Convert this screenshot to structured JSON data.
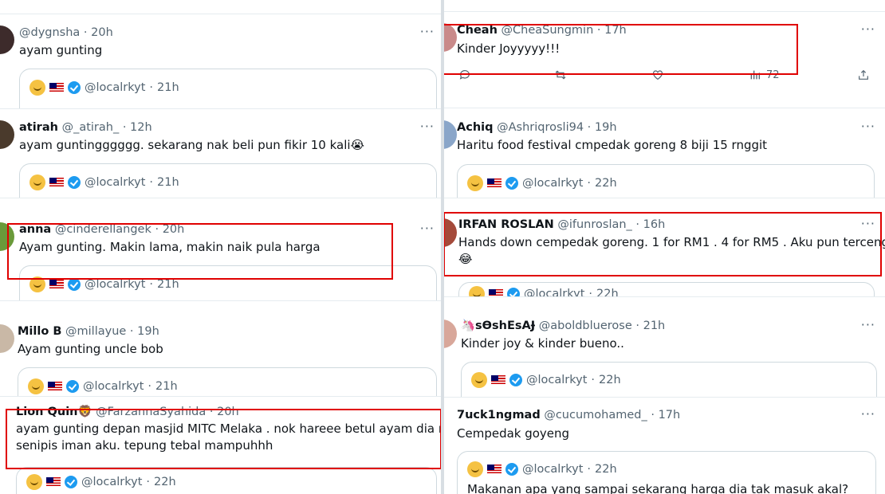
{
  "colors": {
    "accent": "#1d9bf0",
    "highlight": "#e00000"
  },
  "left": [
    {
      "name": "",
      "handle": "@dygnsha",
      "time": "20h",
      "text": "ayam gunting",
      "quote": {
        "handle": "@localrkyt",
        "time": "21h"
      }
    },
    {
      "name": "atirah",
      "handle": "@_atirah_",
      "time": "12h",
      "text": "ayam guntingggggg. sekarang nak beli pun fikir 10 kali😭",
      "quote": {
        "handle": "@localrkyt",
        "time": "21h"
      }
    },
    {
      "name": "anna",
      "handle": "@cinderellangek",
      "time": "20h",
      "text": "Ayam gunting. Makin lama, makin naik pula harga",
      "quote": {
        "handle": "@localrkyt",
        "time": "21h"
      }
    },
    {
      "name": "Millo B",
      "handle": "@millayue",
      "time": "19h",
      "text": "Ayam gunting uncle bob",
      "quote": {
        "handle": "@localrkyt",
        "time": "21h"
      }
    },
    {
      "name": "Lion Quin🦁",
      "handle": "@FarzannaSyahida",
      "time": "20h",
      "text1": "ayam gunting depan masjid MITC Melaka . nok hareee betul ayam dia nipis",
      "text2": "senipis iman aku. tepung tebal mampuhhh",
      "quote": {
        "handle": "@localrkyt",
        "time": "22h"
      }
    }
  ],
  "right": [
    {
      "name": "Cheah",
      "handle": "@CheaSungmin",
      "time": "17h",
      "text": "Kinder Joyyyyy!!!",
      "views": "72"
    },
    {
      "name": "Achiq",
      "handle": "@Ashriqrosli94",
      "time": "19h",
      "text": "Haritu food festival cmpedak goreng 8 biji 15 rnggit",
      "quote": {
        "handle": "@localrkyt",
        "time": "22h"
      }
    },
    {
      "name": "IRFAN ROSLAN",
      "handle": "@ifunroslan_",
      "time": "16h",
      "text1": "Hands down cempedak goreng. 1 for RM1 . 4 for RM5 . Aku pun tercengang",
      "text2": "😂",
      "quote": {
        "handle": "@localrkyt",
        "time": "22h"
      }
    },
    {
      "name": "🦄sƟshEsAɈ",
      "handle": "@aboldbluerose",
      "time": "21h",
      "text": "Kinder joy & kinder bueno..",
      "quote": {
        "handle": "@localrkyt",
        "time": "22h"
      }
    },
    {
      "name": "7uck1ngmad",
      "handle": "@cucumohamed_",
      "time": "17h",
      "text": "Cempedak goyeng",
      "quote": {
        "handle": "@localrkyt",
        "time": "22h",
        "text": "Makanan apa yang sampai sekarang harga dia tak masuk akal?"
      }
    }
  ],
  "ui": {
    "more": "···",
    "dot": "·"
  }
}
